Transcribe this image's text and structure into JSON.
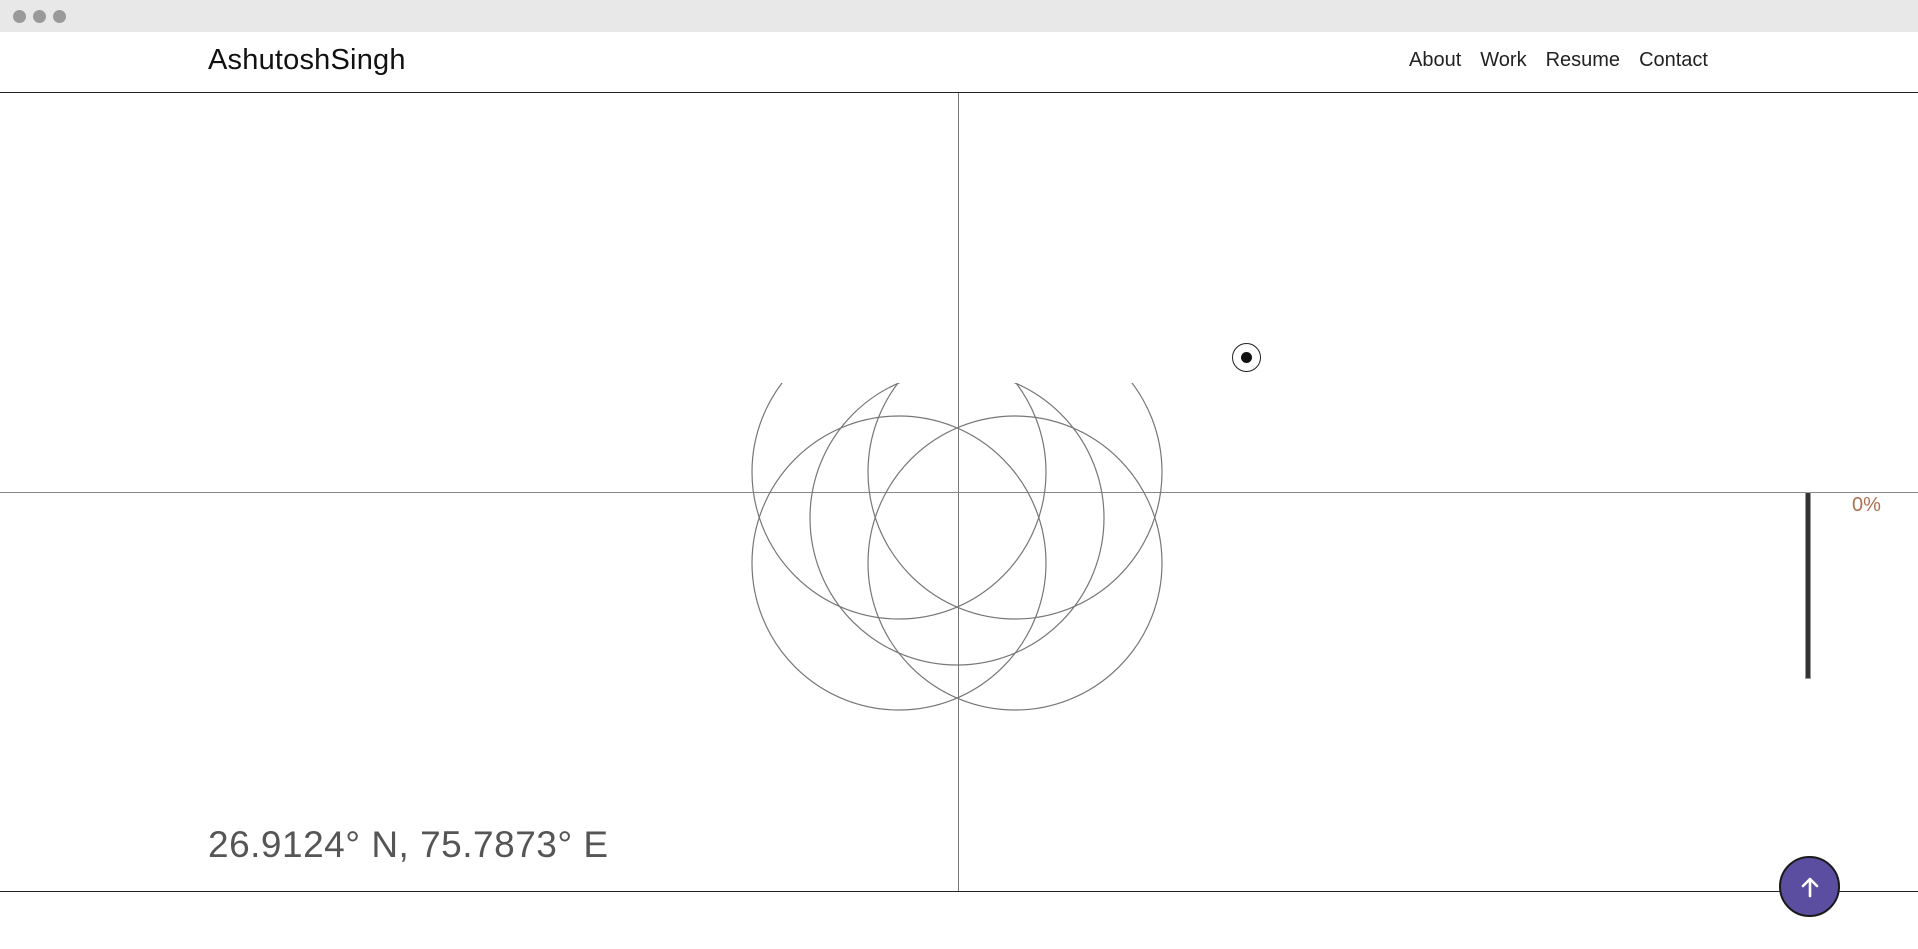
{
  "window": {
    "controls": [
      "close-dot",
      "minimize-dot",
      "maximize-dot"
    ]
  },
  "header": {
    "brand": "AshutoshSingh",
    "nav": [
      {
        "label": "About"
      },
      {
        "label": "Work"
      },
      {
        "label": "Resume"
      },
      {
        "label": "Contact"
      }
    ]
  },
  "scroll_progress": {
    "label": "0%",
    "value": 0
  },
  "location": {
    "coordinates": "26.9124° N, 75.7873° E"
  },
  "scroll_top_button": {
    "icon": "arrow-up-icon"
  },
  "colors": {
    "accent": "#5b4ea0",
    "progress_text": "#b0704f",
    "line": "#777777"
  }
}
